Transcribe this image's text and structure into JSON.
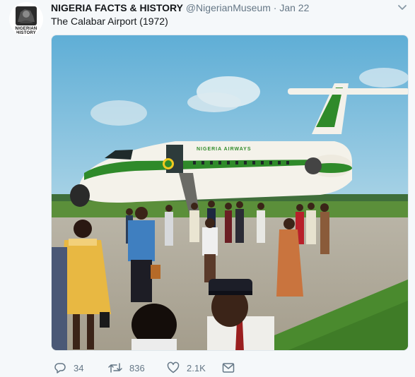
{
  "tweet": {
    "avatar_caption": "NIGERIAN HISTORY",
    "display_name": "NIGERIA FACTS & HISTORY",
    "handle": "@NigerianMuseum",
    "separator": "·",
    "date": "Jan 22",
    "text": "The Calabar Airport (1972)",
    "photo_aircraft_livery": "NIGERIA AIRWAYS",
    "stats": {
      "replies": "34",
      "retweets": "836",
      "likes": "2.1K"
    }
  },
  "colors": {
    "name": "#14171a",
    "muted": "#657786",
    "background": "#f5f8fa",
    "livery_green": "#2f8a2a",
    "sky": "#6fb8dc",
    "grass": "#4a8a2e"
  },
  "icons": {
    "reply": "reply-icon",
    "retweet": "retweet-icon",
    "like": "heart-icon",
    "message": "envelope-icon",
    "more": "chevron-down-icon"
  }
}
